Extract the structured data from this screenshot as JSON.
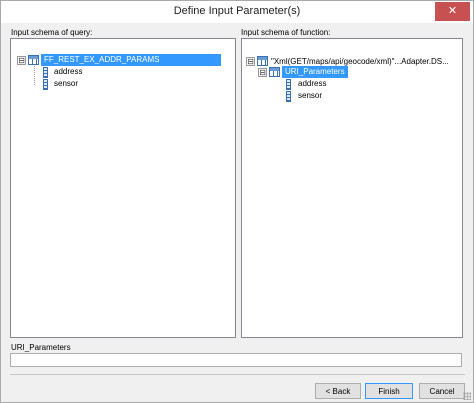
{
  "window": {
    "title": "Define Input Parameter(s)",
    "close_glyph": "✕"
  },
  "left_pane": {
    "label": "Input schema of query:",
    "root": {
      "expander": "⊟",
      "label": "FF_REST_EX_ADDR_PARAMS",
      "children": [
        "address",
        "sensor"
      ]
    }
  },
  "right_pane": {
    "label": "Input schema of function:",
    "root": {
      "expander": "⊟",
      "label": "\"Xml(GET/maps/api/geocode/xml)\"...Adapter.DS...",
      "child": {
        "expander": "⊟",
        "label": "URI_Parameters",
        "children": [
          "address",
          "sensor"
        ]
      }
    }
  },
  "selection_field": {
    "label": "URI_Parameters",
    "value": ""
  },
  "buttons": {
    "back": "< Back",
    "finish": "Finish",
    "cancel": "Cancel"
  },
  "colors": {
    "selection": "#3399ff",
    "close": "#c75050"
  }
}
